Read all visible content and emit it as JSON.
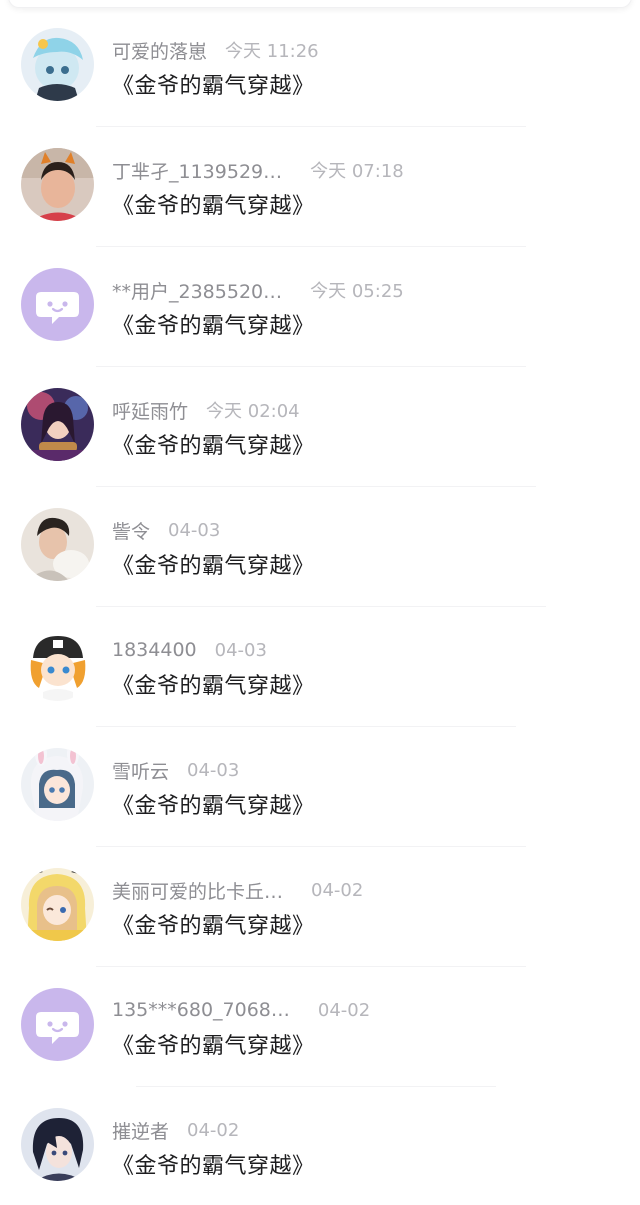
{
  "comments": [
    {
      "user": "可爱的落崽",
      "time": "今天 11:26",
      "book": "《金爷的霸气穿越》",
      "avatar": "anime-blue-hair-avatar"
    },
    {
      "user": "丁芈孑_1139529…",
      "time": "今天 07:18",
      "book": "《金爷的霸气穿越》",
      "avatar": "photo-cat-ears-avatar"
    },
    {
      "user": "**用户_2385520…",
      "time": "今天 05:25",
      "book": "《金爷的霸气穿越》",
      "avatar": "default-chat-bubble-avatar"
    },
    {
      "user": "呼延雨竹",
      "time": "今天 02:04",
      "book": "《金爷的霸气穿越》",
      "avatar": "anime-guitar-avatar"
    },
    {
      "user": "訾令",
      "time": "04-03",
      "book": "《金爷的霸气穿越》",
      "avatar": "photo-man-avatar"
    },
    {
      "user": "1834400",
      "time": "04-03",
      "book": "《金爷的霸气穿越》",
      "avatar": "anime-cap-avatar"
    },
    {
      "user": "雪听云",
      "time": "04-03",
      "book": "《金爷的霸气穿越》",
      "avatar": "anime-bunny-hood-avatar"
    },
    {
      "user": "美丽可爱的比卡丘…",
      "time": "04-02",
      "book": "《金爷的霸气穿越》",
      "avatar": "anime-yellow-hood-avatar"
    },
    {
      "user": "135***680_7068…",
      "time": "04-02",
      "book": "《金爷的霸气穿越》",
      "avatar": "default-chat-bubble-avatar"
    },
    {
      "user": "摧逆者",
      "time": "04-02",
      "book": "《金爷的霸气穿越》",
      "avatar": "anime-dark-hair-avatar"
    }
  ],
  "colors": {
    "name": "#8e8e93",
    "time": "#b6b6bb",
    "book": "#1d1d1f",
    "default_avatar_bg": "#c9b7ec",
    "divider": "#f2f2f4"
  }
}
